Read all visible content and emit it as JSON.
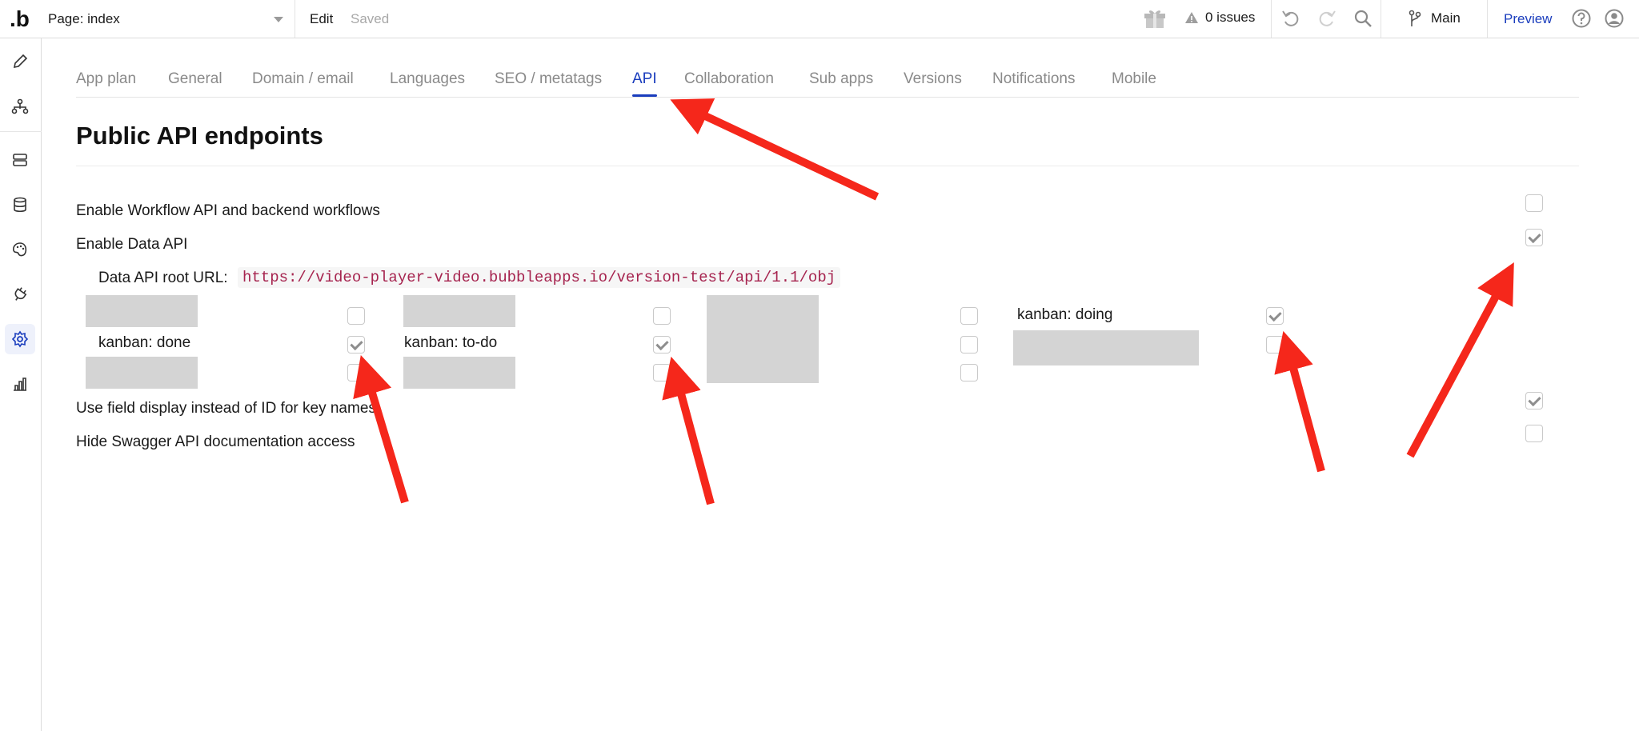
{
  "topbar": {
    "logo": ".b",
    "page_select": "Page: index",
    "edit": "Edit",
    "saved": "Saved",
    "issues": "0 issues",
    "branch": "Main",
    "preview": "Preview"
  },
  "tabs": [
    {
      "label": "App plan"
    },
    {
      "label": "General"
    },
    {
      "label": "Domain / email"
    },
    {
      "label": "Languages"
    },
    {
      "label": "SEO / metatags"
    },
    {
      "label": "API",
      "active": true
    },
    {
      "label": "Collaboration"
    },
    {
      "label": "Sub apps"
    },
    {
      "label": "Versions"
    },
    {
      "label": "Notifications"
    },
    {
      "label": "Mobile"
    }
  ],
  "section": {
    "title": "Public API endpoints",
    "workflow_api": {
      "label": "Enable Workflow API and backend workflows",
      "checked": false
    },
    "data_api": {
      "label": "Enable Data API",
      "checked": true
    },
    "root_url_label": "Data API root URL:",
    "root_url": "https://video-player-video.bubbleapps.io/version-test/api/1.1/obj",
    "types": [
      {
        "label": "kanban: done",
        "checked": true
      },
      {
        "label": "kanban: to-do",
        "checked": true
      },
      {
        "label": "kanban: doing",
        "checked": true
      }
    ],
    "field_display": {
      "label": "Use field display instead of ID for key names",
      "checked": true
    },
    "hide_swagger": {
      "label": "Hide Swagger API documentation access",
      "checked": false
    }
  },
  "colors": {
    "accent": "#1a3dbd",
    "annotation_arrow": "#f5271b",
    "url_text": "#a6244f"
  }
}
